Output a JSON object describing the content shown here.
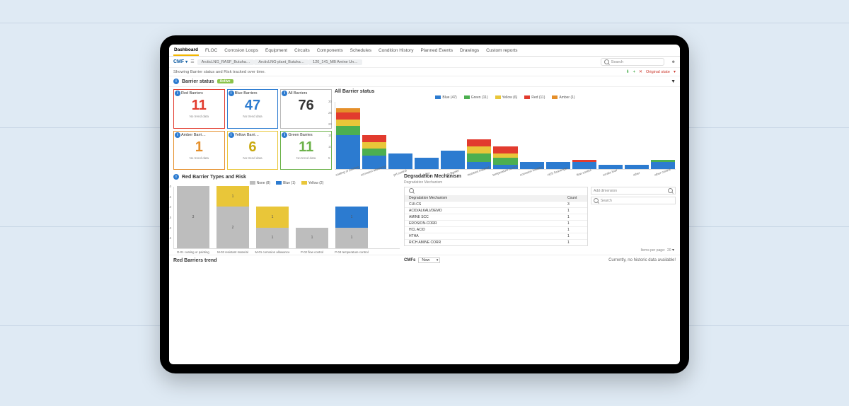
{
  "tabs": [
    "Dashboard",
    "FLOC",
    "Corrosion Loops",
    "Equipment",
    "Circuits",
    "Components",
    "Schedules",
    "Condition History",
    "Planned Events",
    "Drawings",
    "Custom reports"
  ],
  "activeTab": 0,
  "breadcrumb": {
    "cmf": "CMF",
    "crumbs": [
      "ArcticLNG_RASF_Butuha…",
      "ArcticLNG-plant_Butuha…",
      "120_141_MB Amine Un…"
    ]
  },
  "search": {
    "placeholder": "Search"
  },
  "description": "Showing Barrier status and Risk tracked over time.",
  "originalState": "Original state",
  "barrierStatusTitle": "Barrier status",
  "activeLabel": "Active",
  "allBarrierStatusTitle": "All Barrier status",
  "cards": [
    {
      "title": "Red Barriers",
      "value": "11",
      "footer": "No trend data",
      "border": "#e23b2e",
      "color": "#e23b2e"
    },
    {
      "title": "Blue Barriers",
      "value": "47",
      "footer": "No trend data",
      "border": "#2c7bd0",
      "color": "#2c7bd0"
    },
    {
      "title": "All Barriers",
      "value": "76",
      "footer": "",
      "border": "#bbb",
      "color": "#333"
    },
    {
      "title": "Amber Barri…",
      "value": "1",
      "footer": "No trend data",
      "border": "#e58f2a",
      "color": "#e58f2a"
    },
    {
      "title": "Yellow Barri…",
      "value": "6",
      "footer": "No trend data",
      "border": "#e9c639",
      "color": "#c9a90f"
    },
    {
      "title": "Green Barries",
      "value": "11",
      "footer": "No trend data",
      "border": "#6cb24a",
      "color": "#6cb24a"
    }
  ],
  "redBarrierTitle": "Red Barrier Types and Risk",
  "degradation": {
    "title": "Degradation Mechanism",
    "subtitle": "Degradation Mechanism",
    "col1": "Degradation Mechanism",
    "col2": "Count",
    "rows": [
      {
        "name": "CUI-CS",
        "count": "3"
      },
      {
        "name": "ACID/ALKALI/DEMO",
        "count": "1"
      },
      {
        "name": "AMINE SCC",
        "count": "1"
      },
      {
        "name": "EROSION-CORR",
        "count": "1"
      },
      {
        "name": "HCL ACID",
        "count": "1"
      },
      {
        "name": "HTHA",
        "count": "1"
      },
      {
        "name": "RICH AMINE CORR",
        "count": "1"
      }
    ],
    "addDimension": "Add dimension",
    "searchPlaceholder": "Search",
    "footer": "Items per page:",
    "footerVal": "20"
  },
  "row3": {
    "left": "Red Barriers trend",
    "midLabel": "CMFs",
    "midVal": "Now",
    "right": "Currently, no historic data available!"
  },
  "chart_data": [
    {
      "type": "bar",
      "title": "All Barrier status",
      "legend": [
        {
          "name": "Blue (47)",
          "color": "#2c7bd0"
        },
        {
          "name": "Green (11)",
          "color": "#4caf50"
        },
        {
          "name": "Yellow (6)",
          "color": "#e9c639"
        },
        {
          "name": "Red (11)",
          "color": "#e23b2e"
        },
        {
          "name": "Amber (1)",
          "color": "#e58f2a"
        }
      ],
      "ylim": [
        0,
        30
      ],
      "yticks": [
        5,
        10,
        15,
        20,
        25,
        30
      ],
      "categories": [
        "coating or painting",
        "corrosion allowance",
        "pH control",
        "fuller",
        "No Barrier",
        "resistant material",
        "temperature control",
        "corrosion inhibitor",
        "H2S Scavenger",
        "flow control",
        "erratic liner",
        "other",
        "other control"
      ],
      "series": [
        {
          "name": "Blue",
          "color": "#2c7bd0",
          "values": [
            15,
            6,
            7,
            5,
            8,
            3,
            2,
            3,
            3,
            3,
            2,
            2,
            3
          ]
        },
        {
          "name": "Green",
          "color": "#4caf50",
          "values": [
            4,
            3,
            0,
            0,
            0,
            4,
            3,
            0,
            0,
            0,
            0,
            0,
            1
          ]
        },
        {
          "name": "Yellow",
          "color": "#e9c639",
          "values": [
            3,
            3,
            0,
            0,
            0,
            3,
            2,
            0,
            0,
            0,
            0,
            0,
            0
          ]
        },
        {
          "name": "Red",
          "color": "#e23b2e",
          "values": [
            3,
            3,
            0,
            0,
            0,
            3,
            3,
            0,
            0,
            1,
            0,
            0,
            0
          ]
        },
        {
          "name": "Amber",
          "color": "#e58f2a",
          "values": [
            2,
            0,
            0,
            0,
            0,
            0,
            0,
            0,
            0,
            0,
            0,
            0,
            0
          ]
        }
      ]
    },
    {
      "type": "bar",
      "title": "Red Barrier Types and Risk",
      "legend": [
        {
          "name": "None (8)",
          "color": "#bdbdbd"
        },
        {
          "name": "Blue (1)",
          "color": "#2c7bd0"
        },
        {
          "name": "Yellow (2)",
          "color": "#e9c639"
        }
      ],
      "ylim": [
        0,
        3
      ],
      "yticks": [
        0.5,
        1.0,
        1.5,
        2.0,
        2.5,
        3.0
      ],
      "categories": [
        "D-01  coating or painting",
        "M-03  resistant material",
        "M-01  corrosion allowance",
        "P-02  flow control",
        "P-04  temperature control"
      ],
      "series": [
        {
          "name": "None",
          "color": "#bdbdbd",
          "values": [
            3,
            2,
            1,
            1,
            1
          ],
          "labels": [
            "3",
            "2",
            "1",
            "1",
            "1"
          ]
        },
        {
          "name": "Yellow",
          "color": "#e9c639",
          "values": [
            0,
            1,
            1,
            0,
            0
          ],
          "labels": [
            "",
            "1",
            "1",
            "",
            ""
          ]
        },
        {
          "name": "Blue",
          "color": "#2c7bd0",
          "values": [
            0,
            0,
            0,
            0,
            1
          ],
          "labels": [
            "",
            "",
            "",
            "",
            "1"
          ]
        }
      ]
    }
  ]
}
